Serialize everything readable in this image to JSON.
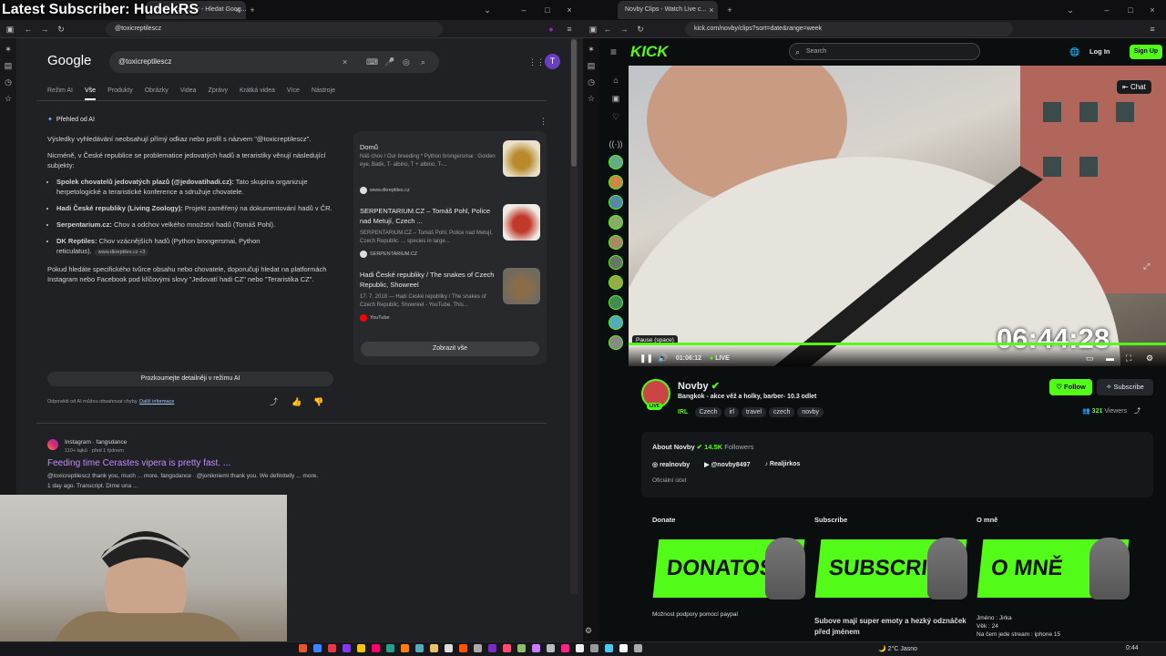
{
  "overlay_title": "Latest Subscriber: HudekRS",
  "left": {
    "tab_title": "@toxicreptilescz - Hledat Goog...",
    "address": "@toxicreptilescz",
    "google_logo": "Google",
    "search_value": "@toxicreptilescz",
    "nav_tabs": [
      "Režim AI",
      "Vše",
      "Produkty",
      "Obrázky",
      "Videa",
      "Zprávy",
      "Krátká videa",
      "Více",
      "Nástroje"
    ],
    "ai_header": "Přehled od AI",
    "ai_p1": "Výsledky vyhledávání neobsahují přímý odkaz nebo profil s názvem \"@toxicreptilescz\".",
    "ai_p2": "Nicméně, v České republice se problematice jedovatých hadů a teraristiky věnují následující subjekty:",
    "bullets": [
      {
        "bold": "Spolek chovatelů jedovatých plazů (@jedovatihadi.cz):",
        "text": " Tato skupina organizuje herpetologické a teraristické konference a sdružuje chovatele."
      },
      {
        "bold": "Hadi České republiky (Living Zoology):",
        "text": " Projekt zaměřený na dokumentování hadů v ČR."
      },
      {
        "bold": "Serpentarium.cz:",
        "text": " Chov a odchov velkého množství hadů (Tomáš Pohl)."
      },
      {
        "bold": "DK Reptiles:",
        "text": " Chov vzácnějších hadů (Python brongersmai, Python reticulatus).",
        "source": "www.dkreptiles.cz +3"
      }
    ],
    "ai_p3": "Pokud hledáte specifického tvůrce obsahu nebo chovatele, doporučuji hledat na platformách Instagram nebo Facebook pod klíčovými slovy \"Jedovatí hadi CZ\" nebo \"Teraristika CZ\".",
    "sources": [
      {
        "title": "Domů",
        "snippet": "Náš chov / Our breeding * Python brongersmai : Golden eye, Batik, T- albino, T + albino, T-...",
        "site": "www.dkreptiles.cz"
      },
      {
        "title": "SERPENTARIUM.CZ – Tomáš Pohl, Police nad Metují, Czech ...",
        "snippet": "SERPENTARIUM.CZ – Tomáš Pohl, Police nad Metují, Czech Republic. ... species in large...",
        "site": "SERPENTARIUM.CZ"
      },
      {
        "title": "Hadi České republiky / The snakes of Czech Republic, Showreel",
        "snippet": "17. 7. 2018 — Hadi České republiky / The snakes of Czech Republic, Showreel - YouTube. This...",
        "site": "YouTube"
      }
    ],
    "show_all": "Zobrazit vše",
    "explore_ai": "Prozkoumejte detailněji v režimu AI",
    "disclaimer": "Odpovědi od AI můžou obsahovat chyby.",
    "more_info": "Další informace",
    "result": {
      "source": "Instagram · fangsdance",
      "meta": "110+ lajků · před 1 týdnem",
      "title": "Feeding time Cerastes vipera is pretty fast. ...",
      "snippet1": "@toxicreptilescz thank you, much ... more. fangsdance · @jonikniemi thank you. We definitelly ... more.",
      "snippet2": "1 day ago. Transcript. Dime una ..."
    },
    "avatar_letter": "T"
  },
  "right": {
    "tab_title": "Novby Clips - Watch Live c...",
    "address": "kick.com/novby/clips?sort=date&range=week",
    "logo": "KICK",
    "search_placeholder": "Search",
    "login": "Log In",
    "signup": "Sign Up",
    "chat": "Chat",
    "tooltip": "Pause (space)",
    "timer": "06:44:28",
    "time": "01:06:12",
    "live": "LIVE",
    "streamer": "Novby",
    "stream_title": "Bangkok -  akce věž a holky, barber- 10.3 odlet",
    "category": "IRL",
    "tags": [
      "Czech",
      "irl",
      "travel",
      "czech",
      "novby"
    ],
    "follow": "Follow",
    "subscribe": "Subscribe",
    "viewers_count": "321",
    "viewers_label": "Viewers",
    "about_title": "About Novby",
    "followers_count": "14.5K",
    "followers_label": "Followers",
    "socials": [
      "realnovby",
      "@novby8497",
      "Realjirkos"
    ],
    "official": "Oficiální účet",
    "panels": [
      {
        "title": "Donate",
        "banner": "DONATOSS",
        "desc": "Možnost podpory pomocí paypal"
      },
      {
        "title": "Subscribe",
        "banner": "SUBSCRIBE",
        "desc": "Subove mají super emoty a hezký odznáček před jménem"
      },
      {
        "title": "O mně",
        "banner": "O MNĚ",
        "desc": "Jméno : Jirka\nVěk : 24\nNa čem jede stream : iphone 15"
      }
    ],
    "live_badge": "LIVE"
  },
  "taskbar": {
    "weather": "2°C  Jasno",
    "clock": "0:44"
  }
}
